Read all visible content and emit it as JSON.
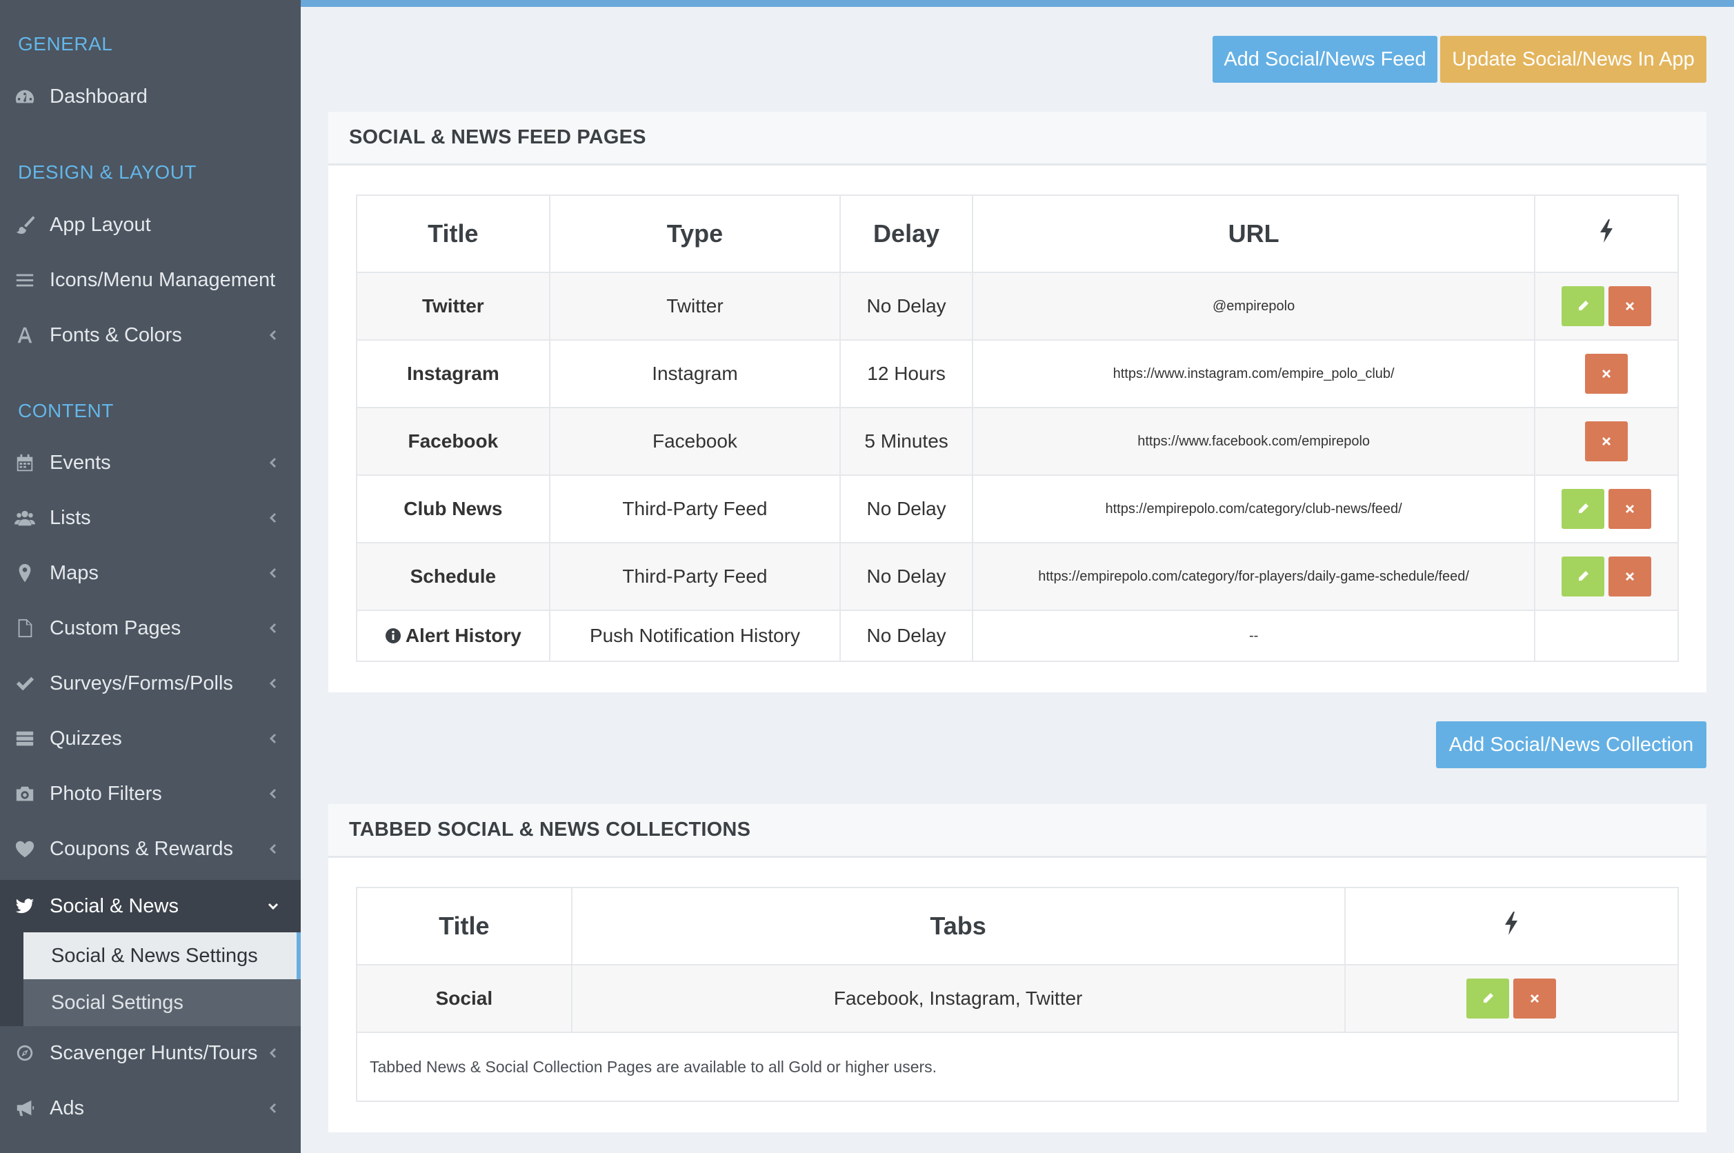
{
  "sidebar": {
    "sections": {
      "general": "GENERAL",
      "design": "DESIGN & LAYOUT",
      "content": "CONTENT"
    },
    "items": {
      "dashboard": "Dashboard",
      "app_layout": "App Layout",
      "icons_menu": "Icons/Menu Management",
      "fonts_colors": "Fonts & Colors",
      "events": "Events",
      "lists": "Lists",
      "maps": "Maps",
      "custom_pages": "Custom Pages",
      "surveys": "Surveys/Forms/Polls",
      "quizzes": "Quizzes",
      "photo_filters": "Photo Filters",
      "coupons": "Coupons & Rewards",
      "social_news": "Social & News",
      "scavenger": "Scavenger Hunts/Tours",
      "ads": "Ads"
    },
    "submenu": {
      "settings": "Social & News Settings",
      "social_settings": "Social Settings"
    }
  },
  "toolbar": {
    "add_feed": "Add Social/News Feed",
    "update_app": "Update Social/News In App",
    "add_collection": "Add Social/News Collection"
  },
  "feeds": {
    "heading": "SOCIAL & NEWS FEED PAGES",
    "columns": {
      "title": "Title",
      "type": "Type",
      "delay": "Delay",
      "url": "URL"
    },
    "rows": [
      {
        "title": "Twitter",
        "type": "Twitter",
        "delay": "No Delay",
        "url": "@empirepolo"
      },
      {
        "title": "Instagram",
        "type": "Instagram",
        "delay": "12 Hours",
        "url": "https://www.instagram.com/empire_polo_club/"
      },
      {
        "title": "Facebook",
        "type": "Facebook",
        "delay": "5 Minutes",
        "url": "https://www.facebook.com/empirepolo"
      },
      {
        "title": "Club News",
        "type": "Third-Party Feed",
        "delay": "No Delay",
        "url": "https://empirepolo.com/category/club-news/feed/"
      },
      {
        "title": "Schedule",
        "type": "Third-Party Feed",
        "delay": "No Delay",
        "url": "https://empirepolo.com/category/for-players/daily-game-schedule/feed/"
      },
      {
        "title": "Alert History",
        "type": "Push Notification History",
        "delay": "No Delay",
        "url": "--"
      }
    ]
  },
  "collections": {
    "heading": "TABBED SOCIAL & NEWS COLLECTIONS",
    "columns": {
      "title": "Title",
      "tabs": "Tabs"
    },
    "rows": [
      {
        "title": "Social",
        "tabs": "Facebook, Instagram, Twitter"
      }
    ],
    "note": "Tabbed News & Social Collection Pages are available to all Gold or higher users."
  },
  "colors": {
    "accent_blue": "#64b0e4",
    "gold": "#e3b55e",
    "edit_green": "#a5d45e",
    "delete_red": "#d97a56",
    "sidebar_bg": "#4c5560"
  }
}
